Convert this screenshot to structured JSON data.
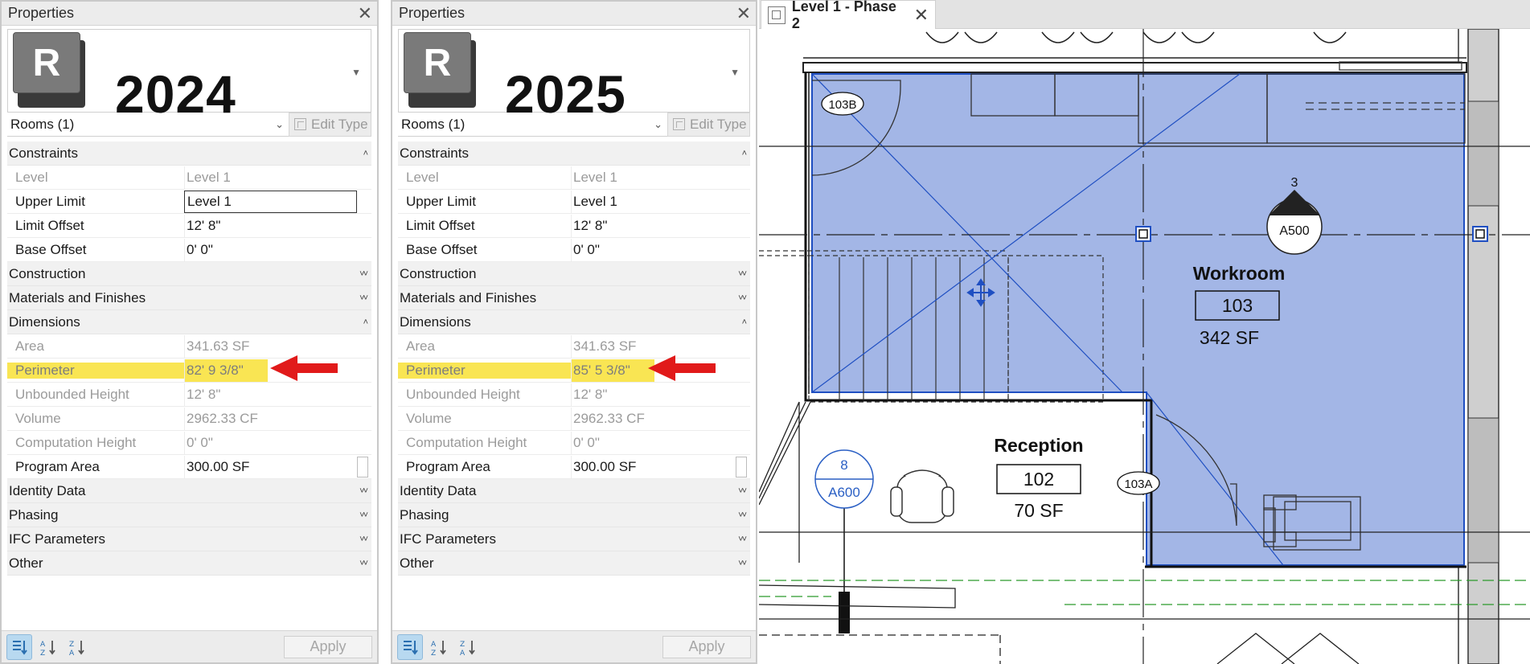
{
  "panels": {
    "left": {
      "title": "Properties",
      "version": "2024",
      "logo_letter": "R",
      "selector": "Rooms (1)",
      "edit_type": "Edit Type",
      "apply": "Apply",
      "groups": {
        "constraints": "Constraints",
        "construction": "Construction",
        "materials": "Materials and Finishes",
        "dimensions": "Dimensions",
        "identity": "Identity Data",
        "phasing": "Phasing",
        "ifc": "IFC Parameters",
        "other": "Other"
      },
      "props": {
        "level": {
          "name": "Level",
          "value": "Level 1"
        },
        "upper_limit": {
          "name": "Upper Limit",
          "value": "Level 1"
        },
        "limit_offset": {
          "name": "Limit Offset",
          "value": "12'  8\""
        },
        "base_offset": {
          "name": "Base Offset",
          "value": "0'  0\""
        },
        "area": {
          "name": "Area",
          "value": "341.63 SF"
        },
        "perimeter": {
          "name": "Perimeter",
          "value": "82'  9 3/8\""
        },
        "unbounded_height": {
          "name": "Unbounded Height",
          "value": "12'  8\""
        },
        "volume": {
          "name": "Volume",
          "value": "2962.33 CF"
        },
        "computation_height": {
          "name": "Computation Height",
          "value": "0'  0\""
        },
        "program_area": {
          "name": "Program Area",
          "value": "300.00 SF"
        }
      }
    },
    "right": {
      "title": "Properties",
      "version": "2025",
      "logo_letter": "R",
      "selector": "Rooms (1)",
      "edit_type": "Edit Type",
      "apply": "Apply",
      "groups": {
        "constraints": "Constraints",
        "construction": "Construction",
        "materials": "Materials and Finishes",
        "dimensions": "Dimensions",
        "identity": "Identity Data",
        "phasing": "Phasing",
        "ifc": "IFC Parameters",
        "other": "Other"
      },
      "props": {
        "level": {
          "name": "Level",
          "value": "Level 1"
        },
        "upper_limit": {
          "name": "Upper Limit",
          "value": "Level 1"
        },
        "limit_offset": {
          "name": "Limit Offset",
          "value": "12'  8\""
        },
        "base_offset": {
          "name": "Base Offset",
          "value": "0'  0\""
        },
        "area": {
          "name": "Area",
          "value": "341.63 SF"
        },
        "perimeter": {
          "name": "Perimeter",
          "value": "85'  5 3/8\""
        },
        "unbounded_height": {
          "name": "Unbounded Height",
          "value": "12'  8\""
        },
        "volume": {
          "name": "Volume",
          "value": "2962.33 CF"
        },
        "computation_height": {
          "name": "Computation Height",
          "value": "0'  0\""
        },
        "program_area": {
          "name": "Program Area",
          "value": "300.00 SF"
        }
      }
    }
  },
  "view": {
    "tab_label": "Level 1 - Phase 2",
    "rooms": {
      "workroom": {
        "name": "Workroom",
        "number": "103",
        "area": "342 SF"
      },
      "reception": {
        "name": "Reception",
        "number": "102",
        "area": "70 SF"
      }
    },
    "door_tags": {
      "d1": "103B",
      "d2": "103A"
    },
    "elevation_tag": {
      "number": "3",
      "sheet": "A500"
    },
    "section_tag": {
      "number": "8",
      "sheet": "A600"
    }
  },
  "colors": {
    "room_fill": "#a3b6e6",
    "room_edge": "#1f4fc2",
    "highlight": "#f9e553",
    "arrow": "#e11a1a",
    "sort_active": "#b8d9f0"
  },
  "icons": [
    "close-icon",
    "revit-logo-icon",
    "chevron-down-icon",
    "edit-type-icon",
    "sort-categorized-icon",
    "sort-ascending-icon",
    "sort-descending-icon",
    "view-plan-icon",
    "arrow-icon",
    "move-cross-icon"
  ]
}
